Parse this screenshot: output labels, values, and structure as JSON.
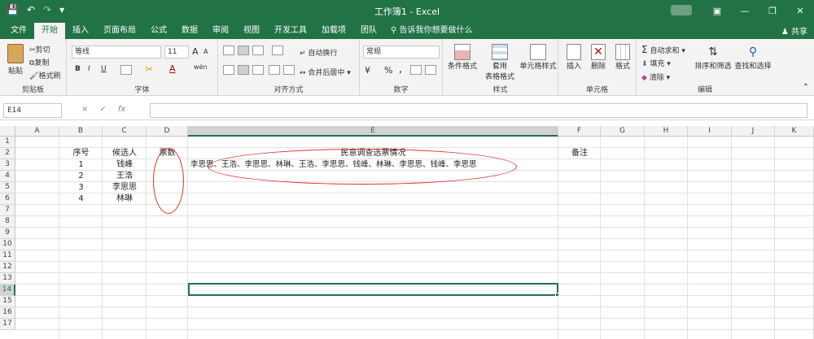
{
  "window": {
    "title": "工作簿1 - Excel",
    "share_label": "共享",
    "tell_me": "告诉我你想要做什么"
  },
  "tabs": [
    "文件",
    "开始",
    "插入",
    "页面布局",
    "公式",
    "数据",
    "审阅",
    "视图",
    "开发工具",
    "加载项",
    "团队"
  ],
  "active_tab": "开始",
  "ribbon": {
    "clipboard": {
      "group": "剪贴板",
      "paste": "粘贴",
      "cut": "剪切",
      "copy": "复制",
      "format_painter": "格式刷"
    },
    "font": {
      "group": "字体",
      "name": "等线",
      "size": "11",
      "bold": "B",
      "italic": "I",
      "underline": "U",
      "grow": "A",
      "shrink": "A",
      "font_color": "A",
      "wen": "wén"
    },
    "alignment": {
      "group": "对齐方式",
      "wrap": "自动换行",
      "merge": "合并后居中"
    },
    "number": {
      "group": "数字",
      "format": "常规",
      "percent": "%",
      "comma": ","
    },
    "styles": {
      "group": "样式",
      "conditional": "条件格式",
      "table": "套用\n表格格式",
      "table_line1": "套用",
      "table_line2": "表格格式",
      "cell_styles": "单元格样式"
    },
    "cells": {
      "group": "单元格",
      "insert": "插入",
      "delete": "删除",
      "format": "格式"
    },
    "editing": {
      "group": "编辑",
      "autosum": "自动求和",
      "fill": "填充",
      "clear": "清除",
      "sort": "排序和筛选",
      "find": "查找和选择"
    }
  },
  "formula_bar": {
    "name_box": "E14",
    "cancel": "×",
    "enter": "✓",
    "fx": "fx",
    "content": ""
  },
  "columns": [
    "A",
    "B",
    "C",
    "D",
    "E",
    "F",
    "G",
    "H",
    "I",
    "J",
    "K"
  ],
  "rows": [
    "1",
    "2",
    "3",
    "4",
    "5",
    "6",
    "7",
    "8",
    "9",
    "10",
    "11",
    "12",
    "13",
    "14",
    "15",
    "16",
    "17"
  ],
  "cells": {
    "B2": "序号",
    "C2": "候选人",
    "D2": "票数",
    "E2": "民意调查选票情况",
    "F2": "备注",
    "B3": "1",
    "C3": "钱峰",
    "B4": "2",
    "C4": "王浩",
    "B5": "3",
    "C5": "李思思",
    "B6": "4",
    "C6": "林琳",
    "E3": "李思思、王浩、李思思、林琳、王浩、李思思、钱峰、林琳、李思思、钱峰、李思思"
  },
  "selected_cell": "E14",
  "annotation_color": "#e03030"
}
